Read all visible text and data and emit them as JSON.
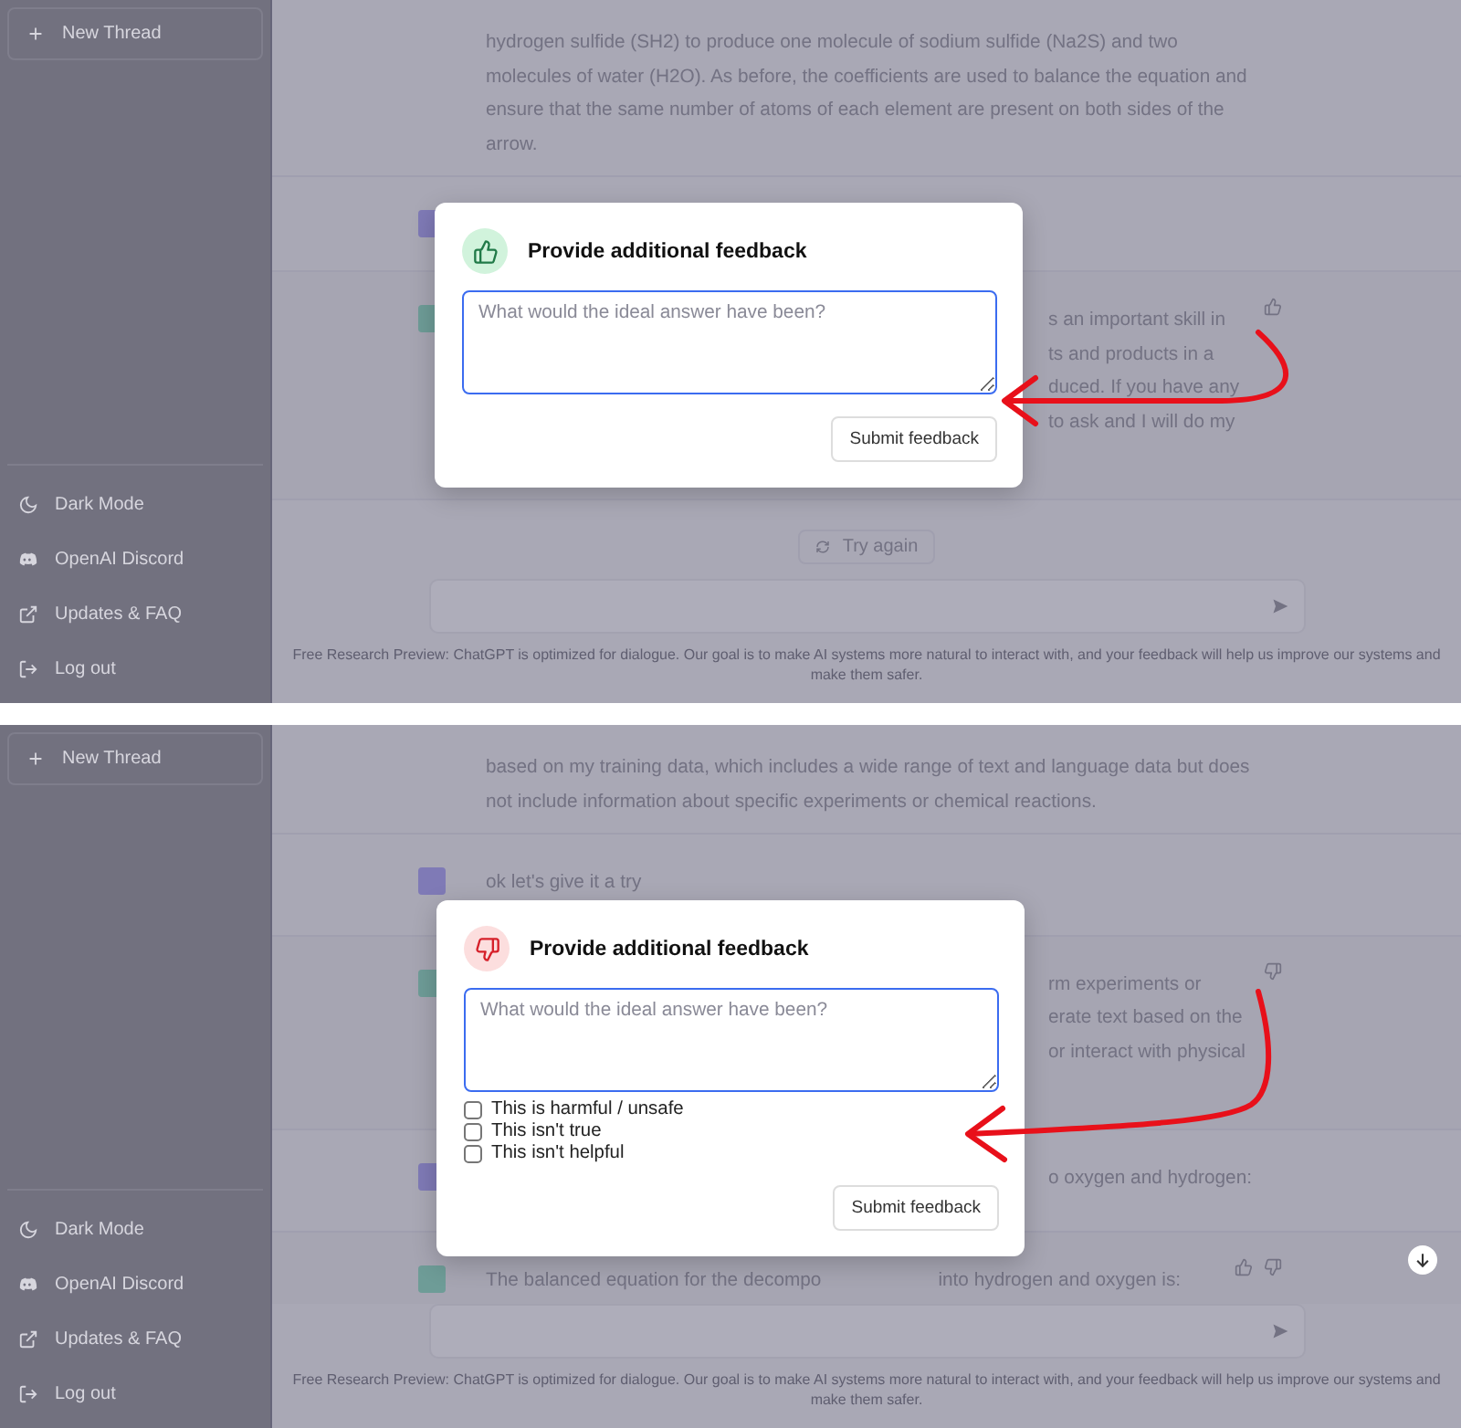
{
  "panels": [
    {
      "sidebar": {
        "new_thread": "New Thread",
        "items": [
          {
            "kind": "theme",
            "label": "Dark Mode"
          },
          {
            "kind": "discord",
            "label": "OpenAI Discord"
          },
          {
            "kind": "external",
            "label": "Updates & FAQ"
          },
          {
            "kind": "logout",
            "label": "Log out"
          }
        ]
      },
      "messages": [
        {
          "kind": "assistant",
          "lines": [
            "hydrogen sulfide (SH2) to produce one molecule of sodium sulfide (Na2S) and two",
            "molecules of water (H2O). As before, the coefficients are used to balance the equation and",
            "ensure that the same number of atoms of each element are present on both sides of the",
            "arrow."
          ]
        },
        {
          "kind": "user"
        },
        {
          "kind": "assistant",
          "partial": true,
          "thumbs_up": true,
          "thumbs_down": false,
          "lines": [
            "s an important skill in",
            "ts and products in a",
            "duced. If you have any",
            "to ask and I will do my"
          ]
        }
      ],
      "retry_button": "Try again",
      "scroll_down_button": false,
      "footer": "Free Research Preview: ChatGPT is optimized for dialogue. Our goal is to make AI systems more natural to interact with, and your feedback will help us improve our systems and make them safer.",
      "dialog": {
        "negative": false,
        "title": "Provide additional feedback",
        "placeholder": "What would the ideal answer have been?",
        "submit": "Submit feedback"
      }
    },
    {
      "sidebar": {
        "new_thread": "New Thread",
        "items": [
          {
            "kind": "theme",
            "label": "Dark Mode"
          },
          {
            "kind": "discord",
            "label": "OpenAI Discord"
          },
          {
            "kind": "external",
            "label": "Updates & FAQ"
          },
          {
            "kind": "logout",
            "label": "Log out"
          }
        ]
      },
      "messages": [
        {
          "kind": "assistant",
          "lines": [
            "based on my training data, which includes a wide range of text and language data but does",
            "not include information about specific experiments or chemical reactions."
          ]
        },
        {
          "kind": "user",
          "lines": [
            "ok let's give it a try"
          ]
        },
        {
          "kind": "assistant",
          "partial": true,
          "thumbs_up": false,
          "thumbs_down": true,
          "lines": [
            "rm experiments or",
            "erate text based on the",
            "or interact with physical"
          ]
        },
        {
          "kind": "user",
          "partial": true,
          "lines": [
            "o oxygen and hydrogen:"
          ]
        },
        {
          "kind": "assistant",
          "thumbs_up": true,
          "thumbs_down": true,
          "lines": [
            "The balanced equation for the decompo"
          ],
          "after_gap": "into hydrogen and oxygen is:"
        }
      ],
      "scroll_down_button": true,
      "footer": "Free Research Preview: ChatGPT is optimized for dialogue. Our goal is to make AI systems more natural to interact with, and your feedback will help us improve our systems and make them safer.",
      "dialog": {
        "negative": true,
        "title": "Provide additional feedback",
        "placeholder": "What would the ideal answer have been?",
        "options": [
          {
            "label": "This is harmful / unsafe",
            "checked": false
          },
          {
            "label": "This isn't true",
            "checked": false
          },
          {
            "label": "This isn't helpful",
            "checked": false
          }
        ],
        "submit": "Submit feedback"
      }
    }
  ]
}
